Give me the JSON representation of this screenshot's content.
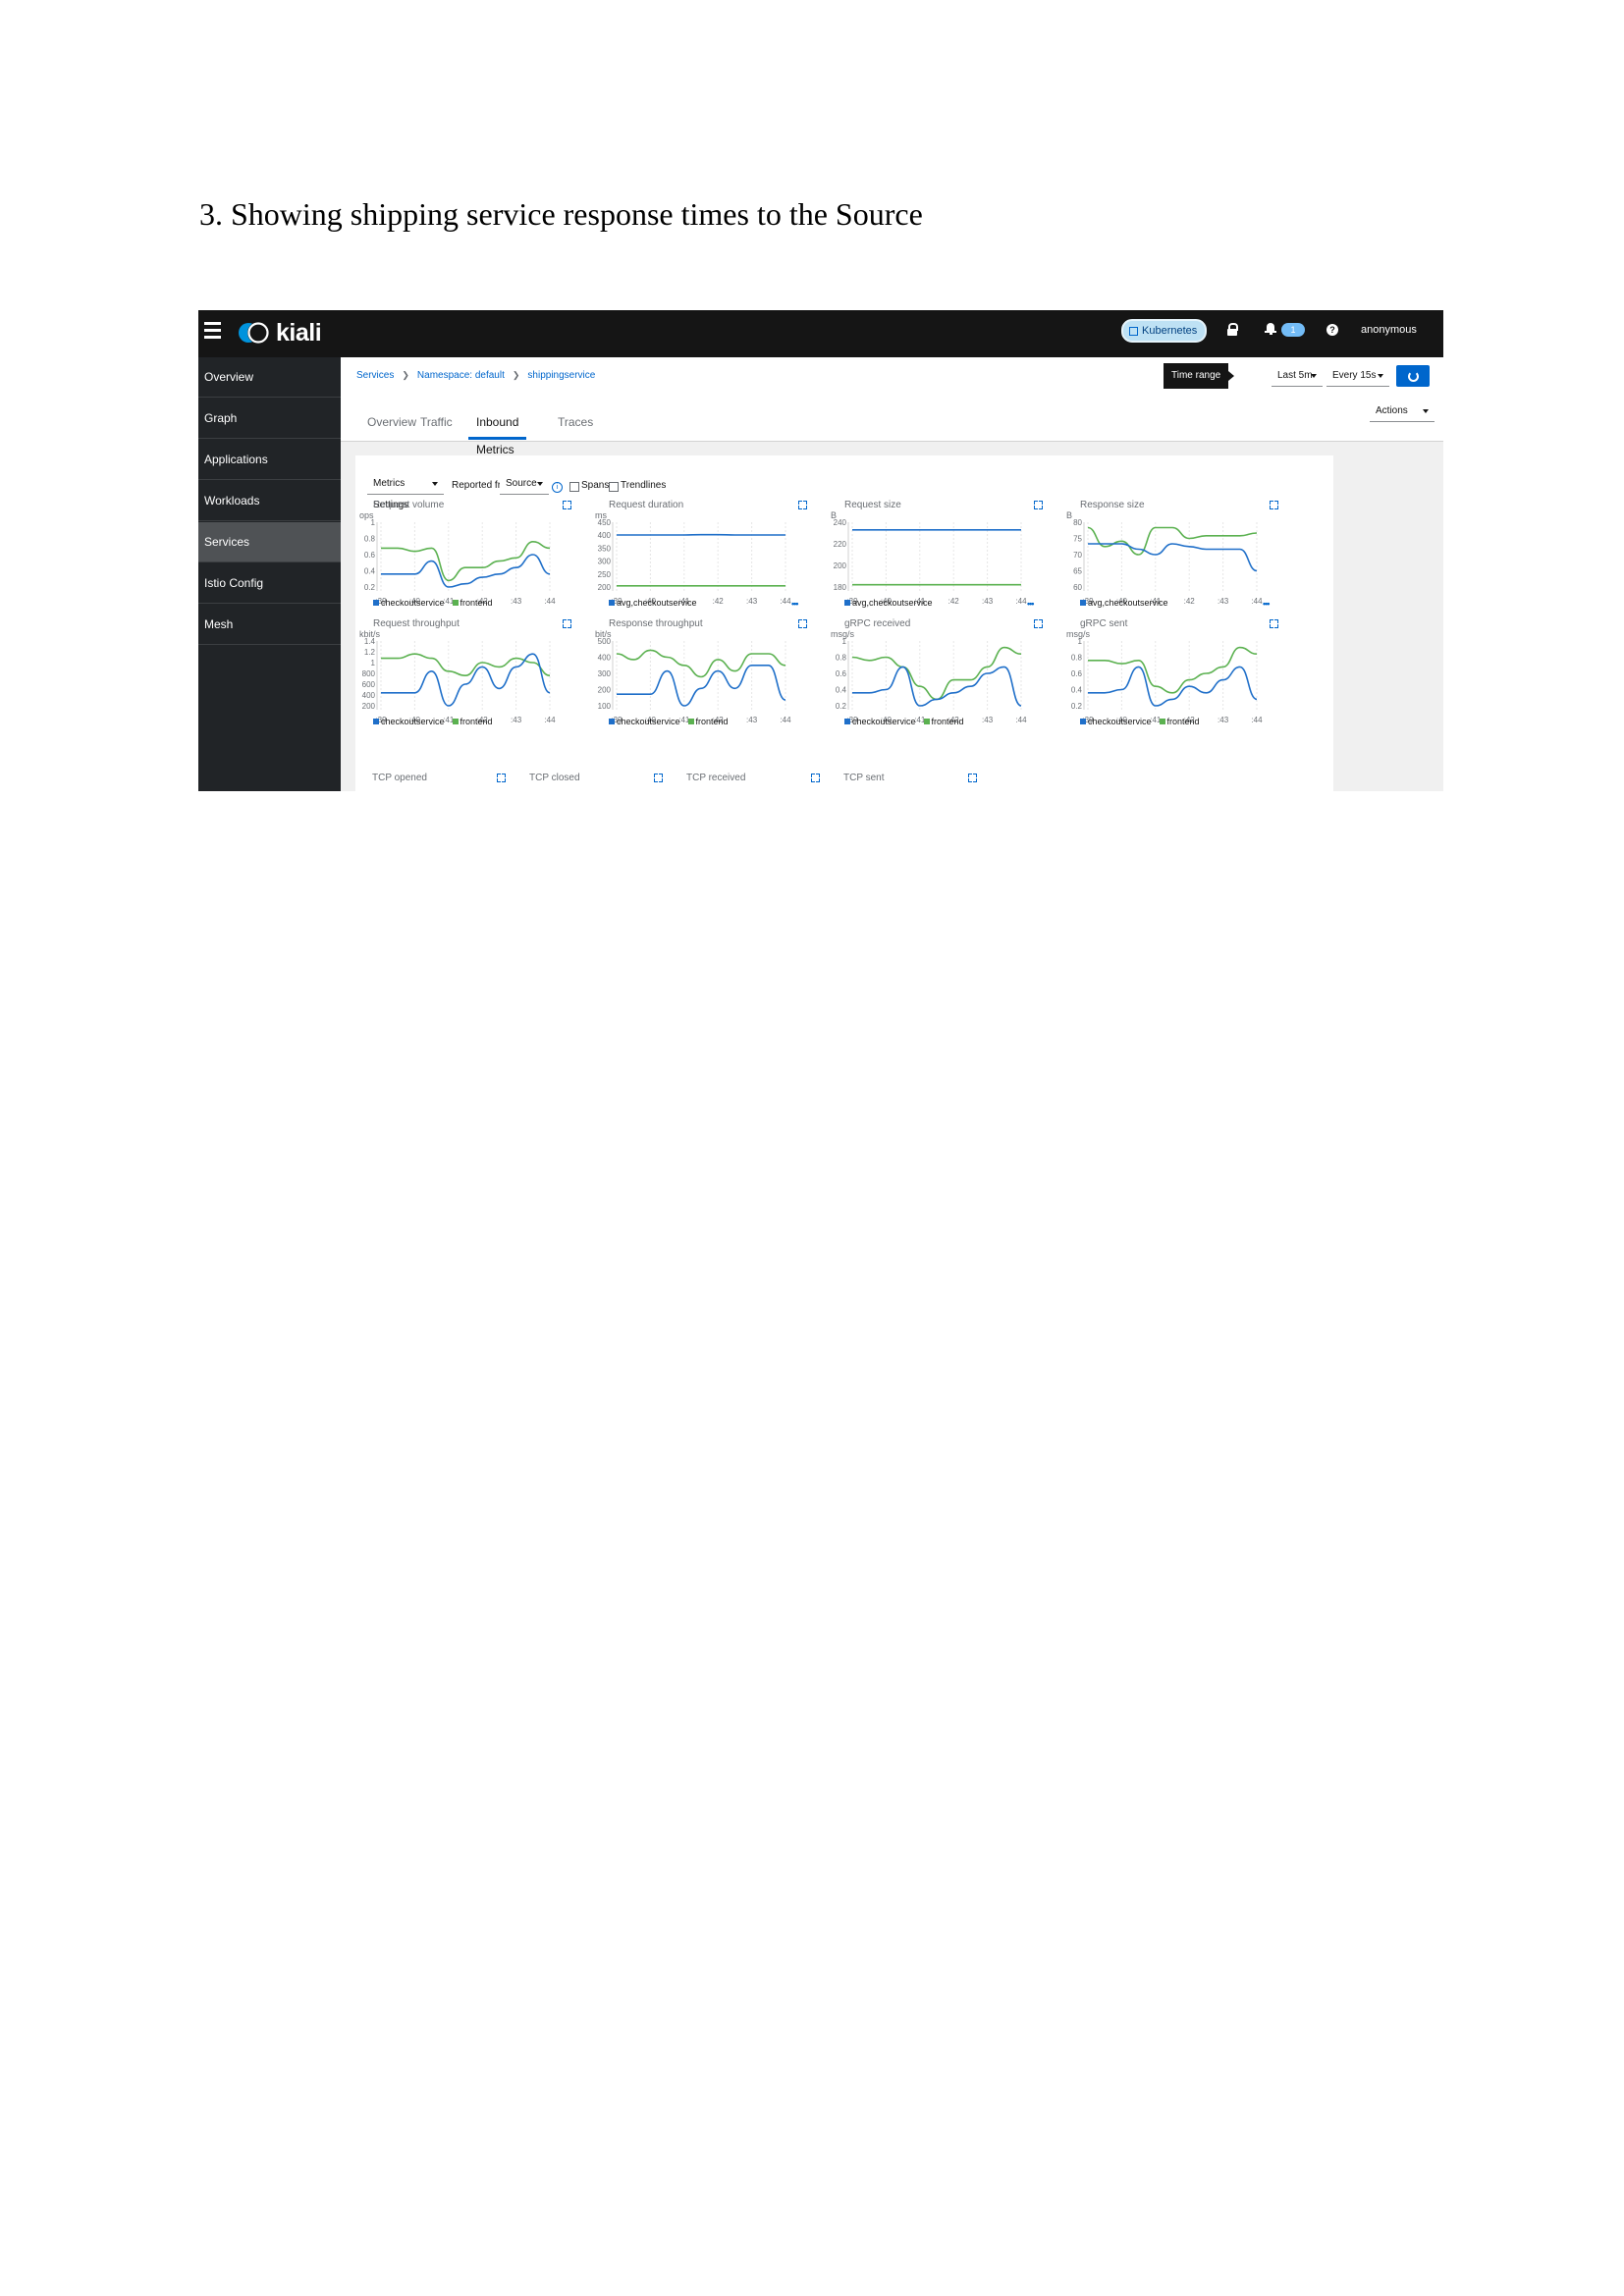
{
  "document": {
    "heading": "3. Showing shipping service response times to the Source"
  },
  "masthead": {
    "brand": "kiali",
    "cluster": "Kubernetes",
    "notification_count": "1",
    "user": "anonymous"
  },
  "sidebar": {
    "items": [
      {
        "label": "Overview"
      },
      {
        "label": "Graph"
      },
      {
        "label": "Applications"
      },
      {
        "label": "Workloads"
      },
      {
        "label": "Services",
        "active": true
      },
      {
        "label": "Istio Config"
      },
      {
        "label": "Mesh"
      }
    ]
  },
  "breadcrumb": [
    "Services",
    "Namespace: default",
    "shippingservice"
  ],
  "toolbar": {
    "time_range_label": "Time range",
    "time_range_value": "Last 5m",
    "refresh_interval": "Every 15s",
    "actions": "Actions"
  },
  "tabs": [
    "Overview",
    "Traffic",
    "Inbound Metrics",
    "Traces"
  ],
  "metrics_toolbar": {
    "metrics_settings": "Metrics Settings",
    "reported_from_label": "Reported from",
    "reported_from_value": "Source",
    "spans": "Spans",
    "trendlines": "Trendlines"
  },
  "colors": {
    "checkoutservice": "#1f6fc9",
    "frontend": "#5bb150",
    "masthead": "#151515",
    "sidebar": "#212427",
    "accent": "#0066cc"
  },
  "bottom_labels": [
    "TCP opened",
    "TCP closed",
    "TCP received",
    "TCP sent"
  ],
  "chart_data": [
    {
      "type": "line",
      "title": "Request volume",
      "ylabel": "ops",
      "x": [
        ":39",
        ":40",
        ":41",
        ":42",
        ":43",
        ":44"
      ],
      "yticks": [
        "1",
        "0.8",
        "0.6",
        "0.4",
        "0.2"
      ],
      "ylim": [
        0,
        1
      ],
      "series": [
        {
          "name": "checkoutservice",
          "values": [
            0.2,
            0.2,
            0.2,
            0.4,
            0.0,
            0.05,
            0.15,
            0.2,
            0.3,
            0.5,
            0.2
          ]
        },
        {
          "name": "frontend",
          "values": [
            0.6,
            0.6,
            0.55,
            0.6,
            0.1,
            0.3,
            0.3,
            0.4,
            0.45,
            0.7,
            0.6
          ]
        }
      ],
      "more": false
    },
    {
      "type": "line",
      "title": "Request duration",
      "ylabel": "ms",
      "x": [
        ":39",
        ":40",
        ":41",
        ":42",
        ":43",
        ":44"
      ],
      "yticks": [
        "450",
        "400",
        "350",
        "300",
        "250",
        "200"
      ],
      "ylim": [
        175,
        460
      ],
      "series": [
        {
          "name": "avg,checkoutservice",
          "values": [
            404,
            404,
            404,
            404,
            404,
            405,
            405,
            404,
            404,
            404,
            404
          ]
        },
        {
          "name": "",
          "values": [
            180,
            180,
            180,
            180,
            180,
            180,
            180,
            180,
            180,
            180,
            180
          ]
        }
      ],
      "more": true
    },
    {
      "type": "line",
      "title": "Request size",
      "ylabel": "B",
      "x": [
        ":39",
        ":40",
        ":41",
        ":42",
        ":43",
        ":44"
      ],
      "yticks": [
        "240",
        "220",
        "200",
        "180"
      ],
      "ylim": [
        170,
        255
      ],
      "series": [
        {
          "name": "avg,checkoutservice",
          "values": [
            245,
            245,
            245,
            245,
            245,
            245,
            245,
            245,
            245,
            245,
            245
          ]
        },
        {
          "name": "",
          "values": [
            173,
            173,
            173,
            173,
            173,
            173,
            173,
            173,
            173,
            173,
            173
          ]
        }
      ],
      "more": true
    },
    {
      "type": "line",
      "title": "Response size",
      "ylabel": "B",
      "x": [
        ":39",
        ":40",
        ":41",
        ":42",
        ":43",
        ":44"
      ],
      "yticks": [
        "80",
        "75",
        "70",
        "65",
        "60"
      ],
      "ylim": [
        58,
        82
      ],
      "series": [
        {
          "name": "avg,checkoutservice",
          "values": [
            74,
            74,
            74,
            72,
            70,
            74,
            73,
            72,
            72,
            72,
            64
          ]
        },
        {
          "name": "",
          "values": [
            80,
            73,
            75,
            70,
            80,
            80,
            76,
            77,
            77,
            77,
            78
          ]
        }
      ],
      "more": true
    },
    {
      "type": "line",
      "title": "Request throughput",
      "ylabel": "kbit/s",
      "x": [
        ":39",
        ":40",
        ":41",
        ":42",
        ":43",
        ":44"
      ],
      "yticks": [
        "1.4",
        "1.2",
        "1",
        "800",
        "600",
        "400",
        "200"
      ],
      "ylim": [
        0,
        1500
      ],
      "series": [
        {
          "name": "checkoutservice",
          "values": [
            300,
            300,
            300,
            800,
            0,
            500,
            900,
            400,
            900,
            1200,
            300
          ]
        },
        {
          "name": "frontend",
          "values": [
            1100,
            1100,
            1200,
            1100,
            800,
            700,
            1000,
            900,
            1100,
            1000,
            700
          ]
        }
      ],
      "more": false
    },
    {
      "type": "line",
      "title": "Response throughput",
      "ylabel": "bit/s",
      "x": [
        ":39",
        ":40",
        ":41",
        ":42",
        ":43",
        ":44"
      ],
      "yticks": [
        "500",
        "400",
        "300",
        "200",
        "100"
      ],
      "ylim": [
        0,
        560
      ],
      "series": [
        {
          "name": "checkoutservice",
          "values": [
            100,
            100,
            100,
            300,
            0,
            150,
            300,
            150,
            350,
            350,
            50
          ]
        },
        {
          "name": "frontend",
          "values": [
            450,
            400,
            480,
            420,
            350,
            250,
            400,
            300,
            450,
            450,
            350
          ]
        }
      ],
      "more": false
    },
    {
      "type": "line",
      "title": "gRPC received",
      "ylabel": "msg/s",
      "x": [
        ":39",
        ":40",
        ":41",
        ":42",
        ":43",
        ":44"
      ],
      "yticks": [
        "1",
        "0.8",
        "0.6",
        "0.4",
        "0.2"
      ],
      "ylim": [
        0,
        1
      ],
      "series": [
        {
          "name": "checkoutservice",
          "values": [
            0.2,
            0.2,
            0.25,
            0.6,
            0.0,
            0.1,
            0.2,
            0.3,
            0.5,
            0.6,
            0.0
          ]
        },
        {
          "name": "frontend",
          "values": [
            0.75,
            0.7,
            0.75,
            0.6,
            0.3,
            0.1,
            0.4,
            0.4,
            0.6,
            0.9,
            0.8
          ]
        }
      ],
      "more": false
    },
    {
      "type": "line",
      "title": "gRPC sent",
      "ylabel": "msg/s",
      "x": [
        ":39",
        ":40",
        ":41",
        ":42",
        ":43",
        ":44"
      ],
      "yticks": [
        "1",
        "0.8",
        "0.6",
        "0.4",
        "0.2"
      ],
      "ylim": [
        0,
        1
      ],
      "series": [
        {
          "name": "checkoutservice",
          "values": [
            0.2,
            0.2,
            0.25,
            0.6,
            0.0,
            0.1,
            0.3,
            0.2,
            0.4,
            0.6,
            0.1
          ]
        },
        {
          "name": "frontend",
          "values": [
            0.7,
            0.7,
            0.65,
            0.7,
            0.3,
            0.2,
            0.4,
            0.5,
            0.6,
            0.9,
            0.8
          ]
        }
      ],
      "more": false
    }
  ]
}
